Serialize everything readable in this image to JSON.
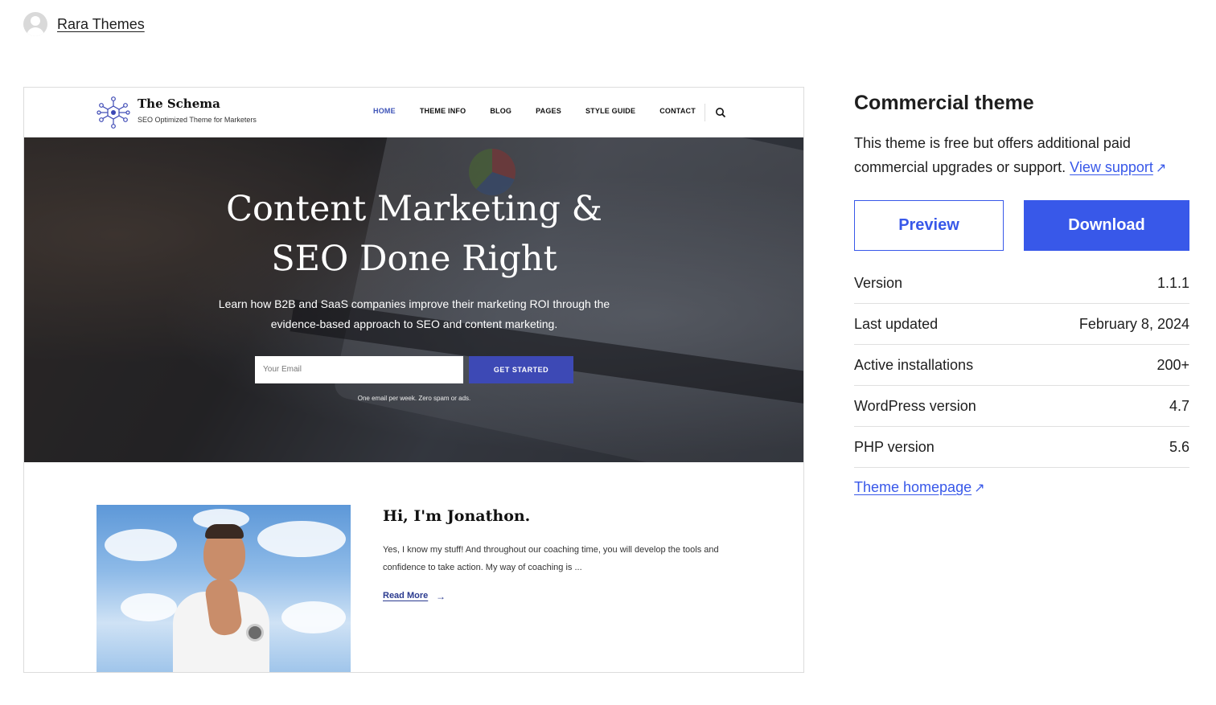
{
  "author": {
    "name": "Rara Themes",
    "avatar_icon": "user-avatar-icon"
  },
  "preview": {
    "site_title": "The Schema",
    "site_tagline": "SEO Optimized Theme for Marketers",
    "nav": [
      "HOME",
      "THEME INFO",
      "BLOG",
      "PAGES",
      "STYLE GUIDE",
      "CONTACT"
    ],
    "nav_active": "HOME",
    "hero_title_line1": "Content Marketing &",
    "hero_title_line2": "SEO Done Right",
    "hero_sub_line1": "Learn how B2B and SaaS companies improve their marketing ROI through the",
    "hero_sub_line2": "evidence-based approach to SEO and content marketing.",
    "email_placeholder": "Your Email",
    "cta_label": "GET STARTED",
    "hero_note": "One email per week. Zero spam or ads.",
    "about_title": "Hi, I'm Jonathon.",
    "about_text": "Yes, I know my stuff! And throughout our coaching time, you will develop the tools and confidence to take action. My way of coaching is ...",
    "read_more": "Read More",
    "accent_color": "#3d49b5"
  },
  "sidebar": {
    "heading": "Commercial theme",
    "description": "This theme is free but offers additional paid commercial upgrades or support.",
    "support_link": "View support",
    "preview_button": "Preview",
    "download_button": "Download",
    "meta": [
      {
        "label": "Version",
        "value": "1.1.1"
      },
      {
        "label": "Last updated",
        "value": "February 8, 2024"
      },
      {
        "label": "Active installations",
        "value": "200+"
      },
      {
        "label": "WordPress version",
        "value": "4.7"
      },
      {
        "label": "PHP version",
        "value": "5.6"
      }
    ],
    "homepage_link": "Theme homepage",
    "accent_color": "#3858e9"
  }
}
